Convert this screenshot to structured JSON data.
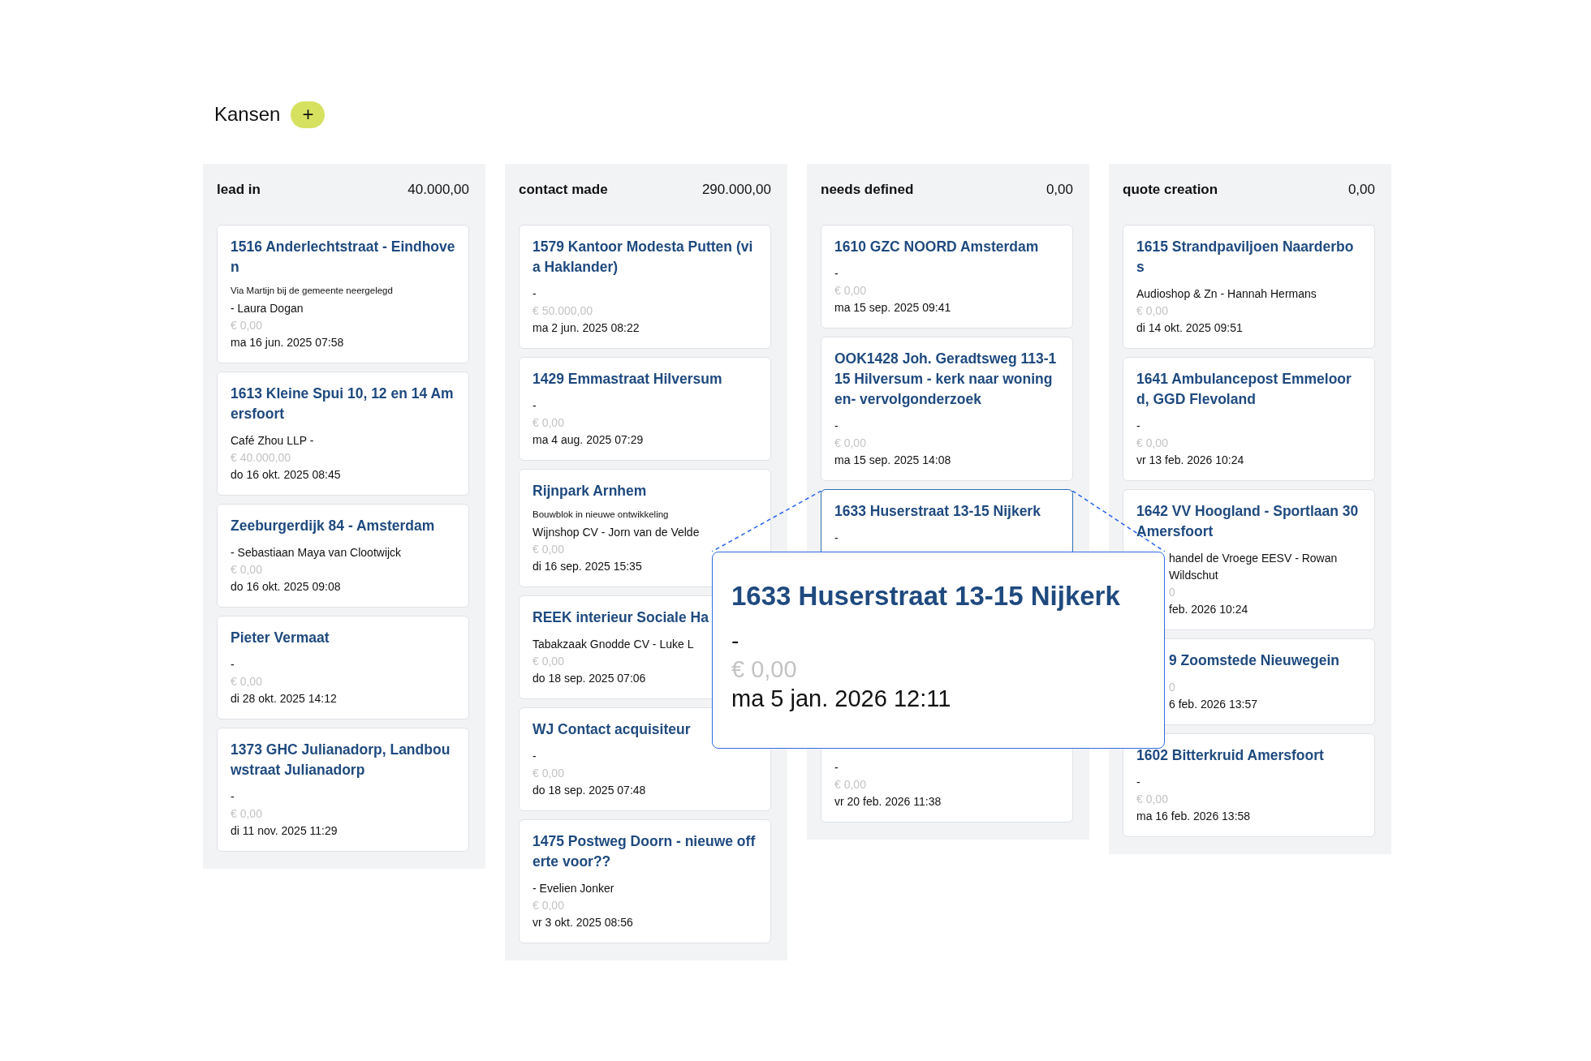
{
  "page": {
    "title": "Kansen",
    "add_button": "+"
  },
  "columns": [
    {
      "name": "lead in",
      "total": "40.000,00",
      "cards": [
        {
          "kind": "full",
          "selected": false,
          "title": "1516 Anderlechtstraat - Eindhoven",
          "note": "Via Martijn bij de gemeente neergelegd",
          "contact": "- Laura Dogan",
          "amount": "€ 0,00",
          "date": "ma 16 jun. 2025 07:58"
        },
        {
          "kind": "full",
          "selected": false,
          "title": "1613 Kleine Spui 10, 12 en 14 Amersfoort",
          "contact": "Café Zhou LLP -",
          "amount": "€ 40.000,00",
          "date": "do 16 okt. 2025 08:45"
        },
        {
          "kind": "full",
          "selected": false,
          "title": "Zeeburgerdijk 84 - Amsterdam",
          "contact": "- Sebastiaan Maya van Clootwijck",
          "amount": "€ 0,00",
          "date": "do 16 okt. 2025 09:08"
        },
        {
          "kind": "full",
          "selected": false,
          "title": "Pieter Vermaat",
          "contact": "-",
          "amount": "€ 0,00",
          "date": "di 28 okt. 2025 14:12"
        },
        {
          "kind": "full",
          "selected": false,
          "title": "1373 GHC Julianadorp, Landbouwstraat Julianadorp",
          "contact": "-",
          "amount": "€ 0,00",
          "date": "di 11 nov. 2025 11:29"
        }
      ]
    },
    {
      "name": "contact made",
      "total": "290.000,00",
      "cards": [
        {
          "kind": "full",
          "selected": false,
          "title": "1579 Kantoor Modesta Putten (via Haklander)",
          "contact": "-",
          "amount": "€ 50.000,00",
          "date": "ma 2 jun. 2025 08:22"
        },
        {
          "kind": "full",
          "selected": false,
          "title": "1429 Emmastraat Hilversum",
          "contact": "-",
          "amount": "€ 0,00",
          "date": "ma 4 aug. 2025 07:29"
        },
        {
          "kind": "full",
          "selected": false,
          "title": "Rijnpark Arnhem",
          "note": "Bouwblok in nieuwe ontwikkeling",
          "contact": "Wijnshop CV - Jorn van de Velde",
          "amount": "€ 0,00",
          "date": "di 16 sep. 2025 15:35"
        },
        {
          "kind": "full",
          "selected": false,
          "title": "REEK interieur Sociale Ha",
          "contact": "Tabakzaak Gnodde CV - Luke L",
          "amount": "€ 0,00",
          "date": "do 18 sep. 2025 07:06"
        },
        {
          "kind": "full",
          "selected": false,
          "title": "WJ Contact acquisiteur",
          "contact": "-",
          "amount": "€ 0,00",
          "date": "do 18 sep. 2025 07:48"
        },
        {
          "kind": "full",
          "selected": false,
          "title": "1475 Postweg Doorn - nieuwe offerte voor??",
          "contact": "- Evelien Jonker",
          "amount": "€ 0,00",
          "date": "vr 3 okt. 2025 08:56"
        }
      ]
    },
    {
      "name": "needs defined",
      "total": "0,00",
      "cards": [
        {
          "kind": "full",
          "selected": false,
          "title": "1610 GZC NOORD Amsterdam",
          "contact": "-",
          "amount": "€ 0,00",
          "date": "ma 15 sep. 2025 09:41"
        },
        {
          "kind": "full",
          "selected": false,
          "title": "OOK1428 Joh. Geradtsweg 113-115 Hilversum - kerk naar woningen- vervolgonderzoek",
          "contact": "-",
          "amount": "€ 0,00",
          "date": "ma 15 sep. 2025 14:08"
        },
        {
          "kind": "covered_bottom",
          "selected": true,
          "title": "1633 Huserstraat 13-15 Nijkerk",
          "contact": "-"
        },
        {
          "kind": "covered_top",
          "selected": false,
          "contact": "-",
          "amount": "€ 0,00",
          "date": "vr 20 feb. 2026 11:38"
        }
      ]
    },
    {
      "name": "quote creation",
      "total": "0,00",
      "cards": [
        {
          "kind": "full",
          "selected": false,
          "title": "1615 Strandpaviljoen Naarderbos",
          "contact": "Audioshop & Zn - Hannah Hermans",
          "amount": "€ 0,00",
          "date": "di 14 okt. 2025 09:51"
        },
        {
          "kind": "full",
          "selected": false,
          "title": "1641 Ambulancepost Emmeloord, GGD Flevoland",
          "contact": "-",
          "amount": "€ 0,00",
          "date": "vr 13 feb. 2026 10:24"
        },
        {
          "kind": "body_covered_left",
          "selected": false,
          "title": "1642 VV Hoogland - Sportlaan 30 Amersfoort",
          "contact": "handel de Vroege EESV - Rowan Wildschut",
          "amount": "0",
          "date": "feb. 2026 10:24"
        },
        {
          "kind": "covered_left",
          "selected": false,
          "title": "9 Zoomstede Nieuwegein",
          "amount": "0",
          "date": "6 feb. 2026 13:57"
        },
        {
          "kind": "full",
          "selected": false,
          "title": "1602 Bitterkruid Amersfoort",
          "contact": "-",
          "amount": "€ 0,00",
          "date": "ma 16 feb. 2026 13:58"
        }
      ]
    }
  ],
  "callout": {
    "title": "1633 Huserstraat 13-15 Nijkerk",
    "contact": "-",
    "amount": "€ 0,00",
    "date": "ma 5 jan. 2026 12:11"
  }
}
